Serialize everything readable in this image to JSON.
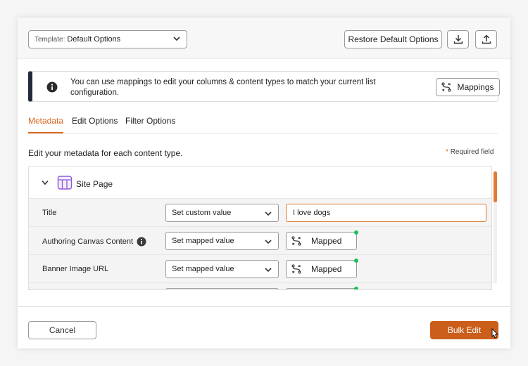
{
  "header": {
    "template_prefix": "Template:",
    "template_value": "Default Options",
    "restore_label": "Restore Default Options",
    "download_icon": "download-icon",
    "upload_icon": "upload-icon"
  },
  "banner": {
    "message": "You can use mappings to edit your columns & content types to match your current list configuration.",
    "mappings_label": "Mappings"
  },
  "tabs": [
    {
      "label": "Metadata",
      "active": true
    },
    {
      "label": "Edit Options",
      "active": false
    },
    {
      "label": "Filter Options",
      "active": false
    }
  ],
  "metadata": {
    "subheading": "Edit your metadata for each content type.",
    "required_star": "*",
    "required_label": "Required field",
    "content_type": "Site Page",
    "rows": [
      {
        "field": "Title",
        "mode": "Set custom value",
        "value": "I love dogs"
      },
      {
        "field": "Authoring Canvas Content",
        "mode": "Set mapped value",
        "value": "Mapped"
      },
      {
        "field": "Banner Image URL",
        "mode": "Set mapped value",
        "value": "Mapped"
      }
    ]
  },
  "footer": {
    "cancel_label": "Cancel",
    "bulk_edit_label": "Bulk Edit"
  },
  "colors": {
    "accent": "#d8661f",
    "primary_button": "#cb5e1a",
    "banner_bar": "#24293d",
    "mapped_dot": "#1bbf5c"
  }
}
